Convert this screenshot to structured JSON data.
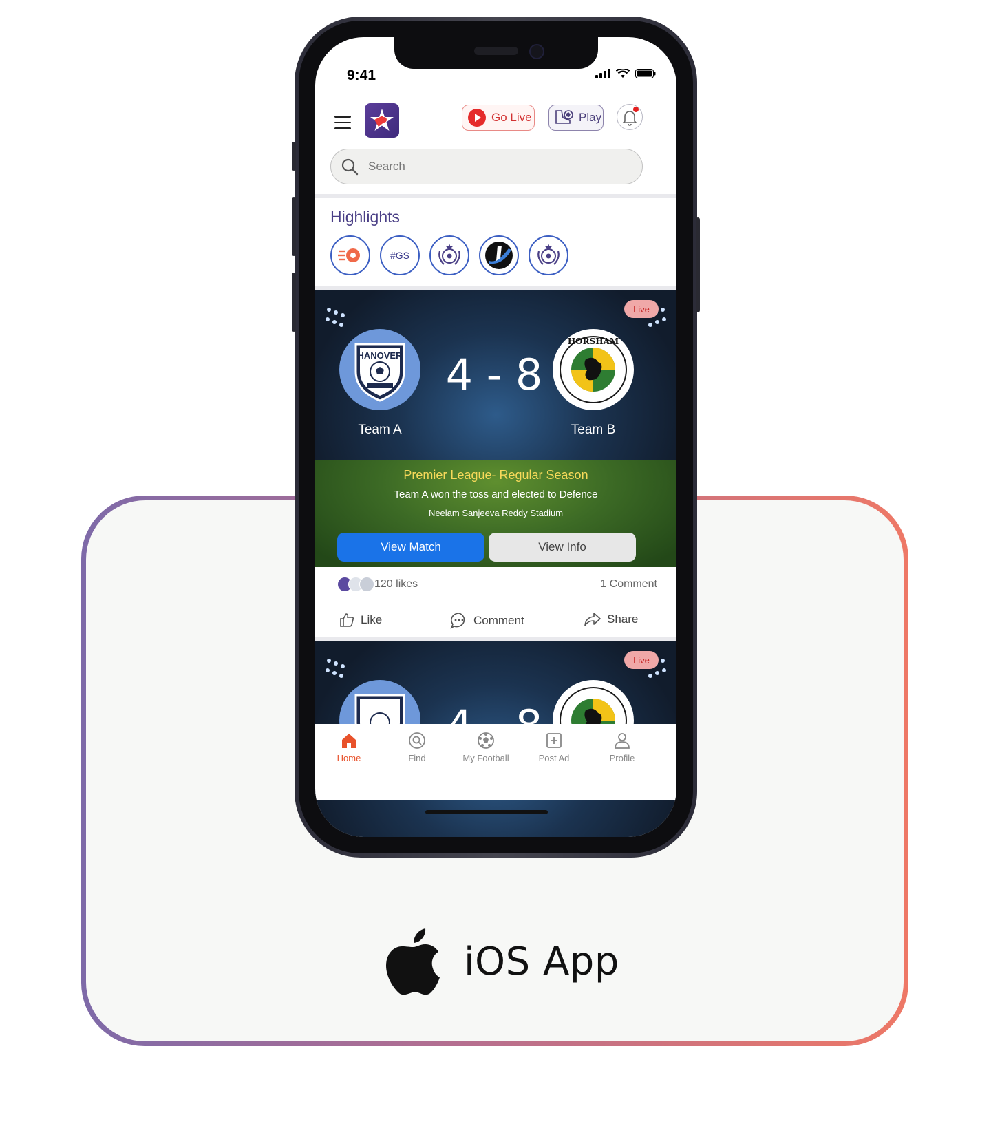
{
  "status_bar": {
    "time": "9:41"
  },
  "header": {
    "go_live_label": "Go Live",
    "play_label": "Play"
  },
  "search": {
    "placeholder": "Search"
  },
  "highlights": {
    "title": "Highlights",
    "items": [
      {
        "label": ""
      },
      {
        "label": "#GS"
      },
      {
        "label": ""
      },
      {
        "label": ""
      },
      {
        "label": ""
      }
    ]
  },
  "match_card": {
    "badge": "Live",
    "score": "4 - 8",
    "team_a": {
      "name": "Team A",
      "logo_text": "HANOVER"
    },
    "team_b": {
      "name": "Team B",
      "logo_text": "HORSHAM"
    },
    "league": "Premier League- Regular Season",
    "toss": "Team A won the toss and elected to Defence",
    "stadium": "Neelam Sanjeeva Reddy Stadium",
    "view_match_label": "View Match",
    "view_info_label": "View Info"
  },
  "engagement": {
    "likes": "120 likes",
    "comments": "1 Comment",
    "like_label": "Like",
    "comment_label": "Comment",
    "share_label": "Share"
  },
  "second_card": {
    "badge": "Live",
    "score": "4 - 8"
  },
  "tabbar": {
    "items": [
      {
        "label": "Home"
      },
      {
        "label": "Find"
      },
      {
        "label": "My Football"
      },
      {
        "label": "Post Ad"
      },
      {
        "label": "Profile"
      }
    ],
    "active_color": "#e8522b"
  },
  "platform": {
    "label": "iOS App"
  }
}
